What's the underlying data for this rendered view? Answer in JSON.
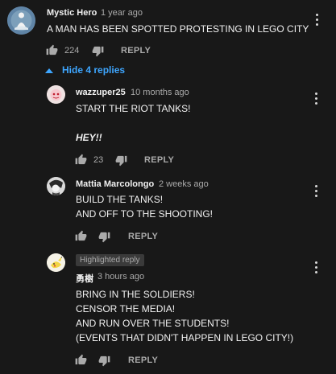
{
  "comment": {
    "author": "Mystic Hero",
    "time": "1 year ago",
    "text": "A MAN HAS BEEN SPOTTED PROTESTING IN LEGO CITY",
    "likes": "224",
    "reply_label": "REPLY"
  },
  "toggle": {
    "label": "Hide 4 replies"
  },
  "replies": [
    {
      "author": "wazzuper25",
      "time": "10 months ago",
      "lines": [
        "START THE RIOT TANKS!",
        "",
        "HEY!!"
      ],
      "likes": "23",
      "reply_label": "REPLY"
    },
    {
      "author": "Mattia Marcolongo",
      "time": "2 weeks ago",
      "lines": [
        "BUILD THE TANKS!",
        "AND OFF TO THE SHOOTING!"
      ],
      "likes": "",
      "reply_label": "REPLY"
    },
    {
      "badge": "Highlighted reply",
      "author": "勇樹",
      "time": "3 hours ago",
      "lines": [
        "BRING IN THE SOLDIERS!",
        "CENSOR THE MEDIA!",
        "AND RUN OVER THE STUDENTS!",
        "(EVENTS THAT DIDN'T HAPPEN IN LEGO CITY!)"
      ],
      "likes": "",
      "reply_label": "REPLY"
    }
  ]
}
